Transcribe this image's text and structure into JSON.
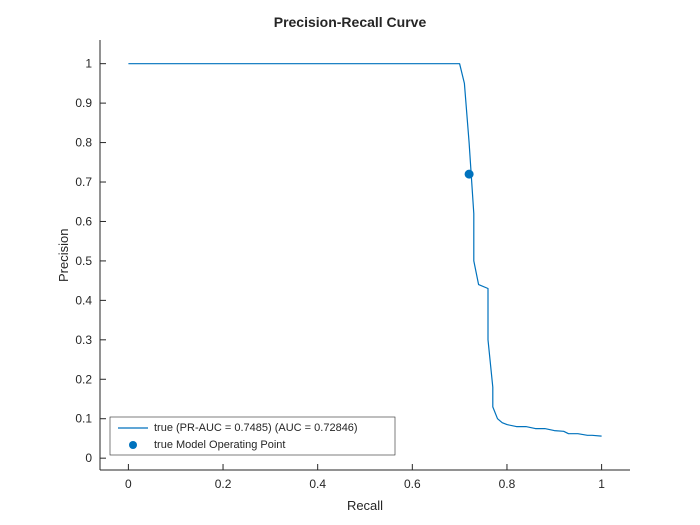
{
  "chart_data": {
    "type": "line",
    "title": "Precision-Recall Curve",
    "xlabel": "Recall",
    "ylabel": "Precision",
    "xlim": [
      -0.06,
      1.06
    ],
    "ylim": [
      -0.03,
      1.06
    ],
    "xticks": [
      0,
      0.2,
      0.4,
      0.6,
      0.8,
      1
    ],
    "yticks": [
      0,
      0.1,
      0.2,
      0.3,
      0.4,
      0.5,
      0.6,
      0.7,
      0.8,
      0.9,
      1
    ],
    "series": [
      {
        "name": "true (PR-AUC = 0.7485) (AUC = 0.72846)",
        "type": "line",
        "color": "#0072BD",
        "x": [
          0.0,
          0.02,
          0.7,
          0.71,
          0.72,
          0.73,
          0.73,
          0.74,
          0.76,
          0.76,
          0.77,
          0.77,
          0.78,
          0.79,
          0.8,
          0.82,
          0.84,
          0.86,
          0.88,
          0.9,
          0.92,
          0.93,
          0.95,
          0.97,
          0.98,
          1.0
        ],
        "y": [
          1.0,
          1.0,
          1.0,
          0.95,
          0.8,
          0.62,
          0.5,
          0.44,
          0.43,
          0.3,
          0.18,
          0.13,
          0.1,
          0.09,
          0.085,
          0.08,
          0.08,
          0.075,
          0.075,
          0.07,
          0.068,
          0.062,
          0.062,
          0.058,
          0.058,
          0.056
        ]
      },
      {
        "name": "true Model Operating Point",
        "type": "point",
        "color": "#0072BD",
        "x": [
          0.72
        ],
        "y": [
          0.72
        ]
      }
    ],
    "legend_position": "lower-left"
  },
  "legend": {
    "items": [
      "true (PR-AUC = 0.7485) (AUC = 0.72846)",
      "true Model Operating Point"
    ]
  }
}
